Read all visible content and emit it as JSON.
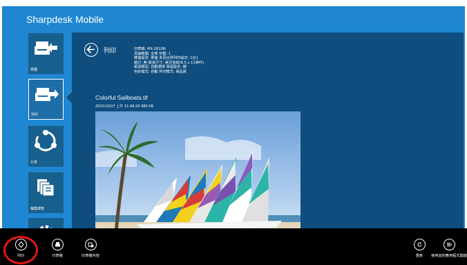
{
  "app": {
    "title": "Sharpdesk Mobile"
  },
  "sidebar": {
    "items": [
      {
        "label": "掃描",
        "icon": "scan-icon"
      },
      {
        "label": "列印",
        "icon": "print-icon",
        "active": true
      },
      {
        "label": "分享",
        "icon": "share-icon"
      },
      {
        "label": "檔案總管",
        "icon": "file-manager-icon"
      },
      {
        "label": "",
        "icon": "settings-gear-icon"
      }
    ]
  },
  "panel": {
    "title": "列印",
    "settings": [
      "印表機: MX-2610N",
      "頁面範圍: 全部   份數: 1",
      "雙面設定: 單面   多頁合併列印設定: 1合1",
      "裝訂: 無   紙張尺寸: 美式信紙(8.5 x 11英吋)",
      "紙張類型: 自動選擇   保留設定: 關",
      "色彩模式: 自動   列印模式: 高品質"
    ],
    "file_name": "Colorful Sailboats.tif",
    "file_meta": "2015/10/27 上午 11:49:20 985 KB"
  },
  "appbar": {
    "left": [
      {
        "label": "列印",
        "icon": "print-go-icon"
      },
      {
        "label": "印表機",
        "icon": "printer-icon"
      },
      {
        "label": "印表機內容",
        "icon": "printer-settings-icon"
      }
    ],
    "right": [
      {
        "label": "重新",
        "icon": "refresh-icon"
      },
      {
        "label": "使用其他應用程式開啟",
        "icon": "open-with-icon"
      }
    ]
  },
  "colors": {
    "background": "#1f87d2",
    "panel": "#0f4d7e",
    "tile": "#175f8d",
    "appbar": "#000000",
    "highlight": "#e81414"
  }
}
